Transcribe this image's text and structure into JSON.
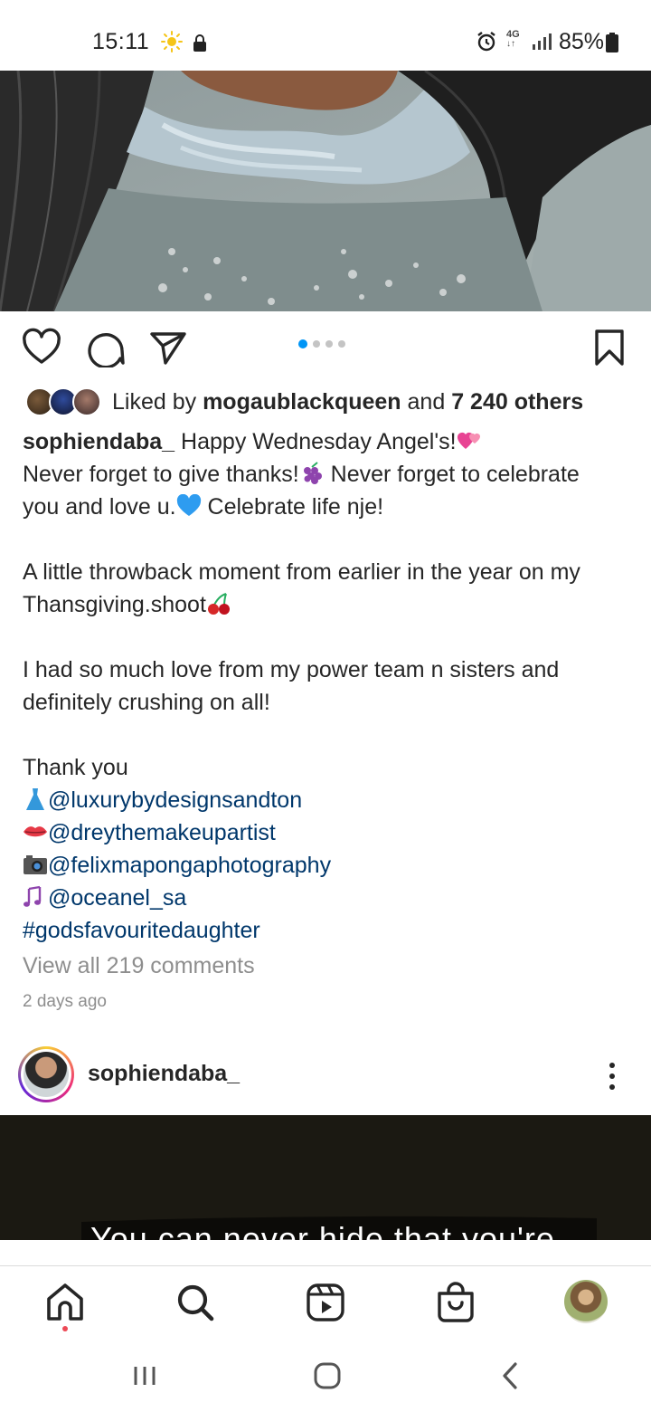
{
  "status_bar": {
    "time": "15:11",
    "network": "4G",
    "battery": "85%"
  },
  "post": {
    "carousel_total": 4,
    "carousel_active": 1,
    "likes": {
      "prefix": "Liked by",
      "user": "mogaublackqueen",
      "joiner": "and",
      "others": "7 240 others"
    },
    "caption": {
      "username": "sophiendaba_",
      "line1": "Happy Wednesday Angel's!",
      "line2a": "Never forget to give thanks!",
      "line2b": " Never forget to celebrate",
      "line3a": "you and love u.",
      "line3b": " Celebrate life nje!",
      "line4": "A little throwback moment from earlier in the year on my",
      "line5": "Thansgiving.shoot",
      "line6": "I had so much love from my power team n sisters and",
      "line7": "definitely crushing on all!",
      "thank_you": " Thank you",
      "credit_dress": "@luxurybydesignsandton",
      "credit_makeup": "@dreythemakeupartist",
      "credit_photo": "@felixmapongaphotography",
      "credit_music": "@oceanel_sa",
      "hashtag": "#godsfavouritedaughter"
    },
    "view_comments": "View all 219 comments",
    "date": "2 days ago"
  },
  "next_post": {
    "username": "sophiendaba_",
    "photo_text": "You can never hide that you're"
  },
  "icons": {
    "like": "heart-icon",
    "comment": "comment-icon",
    "share": "send-icon",
    "save": "bookmark-icon",
    "more": "more-vertical-icon",
    "nav": [
      "home-icon",
      "search-icon",
      "reels-icon",
      "shop-icon",
      "profile-avatar"
    ],
    "system": [
      "recents-icon",
      "home-circle-icon",
      "back-icon"
    ]
  },
  "colors": {
    "link": "#00376b",
    "accent_blue": "#0095f6",
    "muted": "#8e8e8e",
    "notification_dot": "#ed4956"
  }
}
